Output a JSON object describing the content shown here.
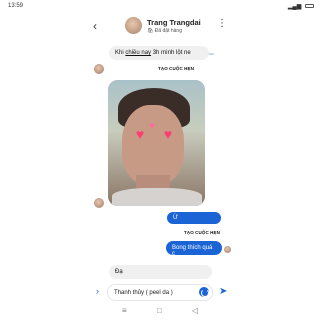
{
  "status_bar": {
    "time": "13:59"
  },
  "header": {
    "name": "Trang Trangdai",
    "status": "Đã đặt hàng",
    "back_icon": "chevron-left-icon",
    "menu_icon": "more-vertical-icon"
  },
  "messages": [
    {
      "text_before": "Khi ",
      "text_link": "chiều nay",
      "text_after": " 3h mình lột ne",
      "direction": "in"
    },
    {
      "link": "TẠO CUỘC HẸN"
    },
    {
      "photo": "selfie-with-heart-stickers"
    },
    {
      "text": "Ừ",
      "direction": "out",
      "link": "TẠO CUỘC HẸN"
    },
    {
      "text": "Bong thích quá c",
      "direction": "out"
    },
    {
      "text": "Đạ",
      "direction": "in"
    }
  ],
  "composer": {
    "value": "Thanh thủy ( peel da )",
    "expand_icon": "chevron-right-icon",
    "emoji_icon": "emoji-icon",
    "send_icon": "send-icon"
  },
  "nav": {
    "menu": "≡",
    "home": "□",
    "back": "◁"
  },
  "colors": {
    "accent": "#1a64d6",
    "bubble_in": "#f0f0f0"
  }
}
